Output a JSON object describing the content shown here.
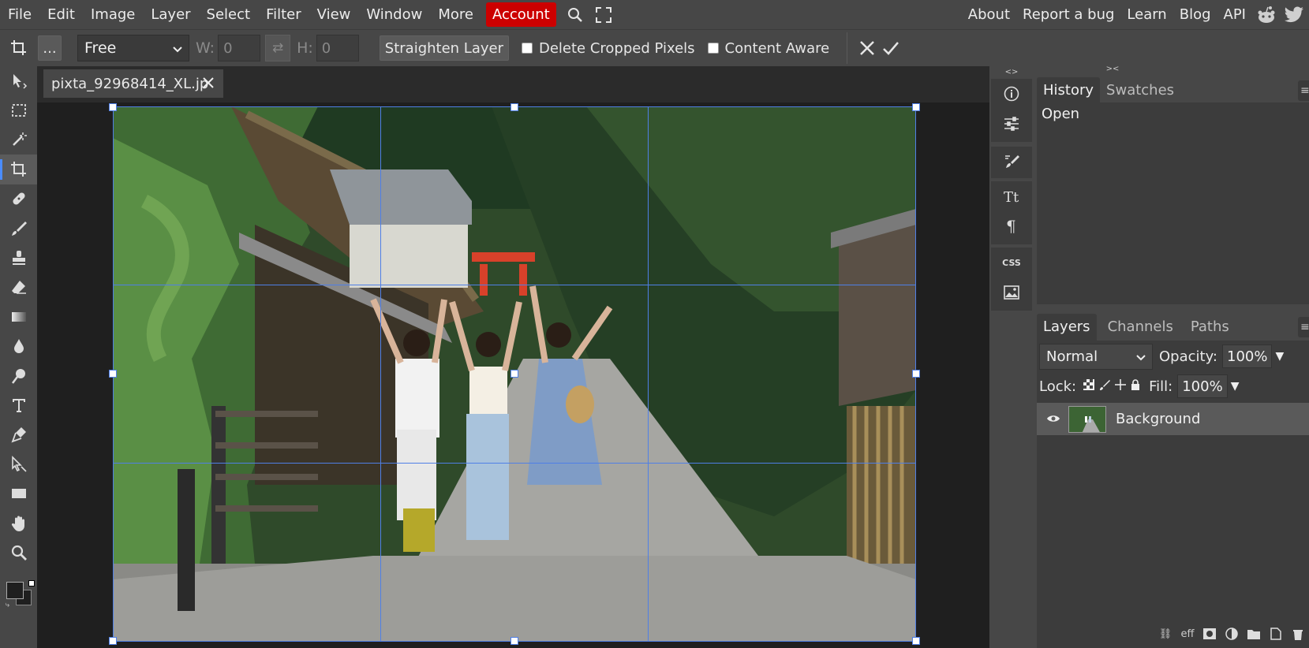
{
  "menu": {
    "items": [
      "File",
      "Edit",
      "Image",
      "Layer",
      "Select",
      "Filter",
      "View",
      "Window",
      "More"
    ],
    "account": "Account",
    "links": [
      "About",
      "Report a bug",
      "Learn",
      "Blog",
      "API"
    ]
  },
  "options": {
    "more_label": "...",
    "aspect_value": "Free",
    "w_label": "W:",
    "w_value": "0",
    "h_label": "H:",
    "h_value": "0",
    "straighten_label": "Straighten Layer",
    "delete_cropped_label": "Delete Cropped Pixels",
    "content_aware_label": "Content Aware"
  },
  "document": {
    "tab_title": "pixta_92968414_XL.jp"
  },
  "icon_panel": {
    "collapse_left": "<>",
    "collapse_right": "><",
    "css_label": "CSS"
  },
  "history": {
    "tabs": [
      "History",
      "Swatches"
    ],
    "items": [
      "Open"
    ]
  },
  "layers": {
    "tabs": [
      "Layers",
      "Channels",
      "Paths"
    ],
    "blend_mode": "Normal",
    "opacity_label": "Opacity:",
    "opacity_value": "100%",
    "lock_label": "Lock:",
    "fill_label": "Fill:",
    "fill_value": "100%",
    "layer_items": [
      "Background"
    ],
    "footer_effects": "eff"
  },
  "colors": {
    "accent": "#4f7fe6",
    "account_bg": "#cc0000",
    "panel_bg": "#474747",
    "panel_inner": "#3c3c3c"
  }
}
